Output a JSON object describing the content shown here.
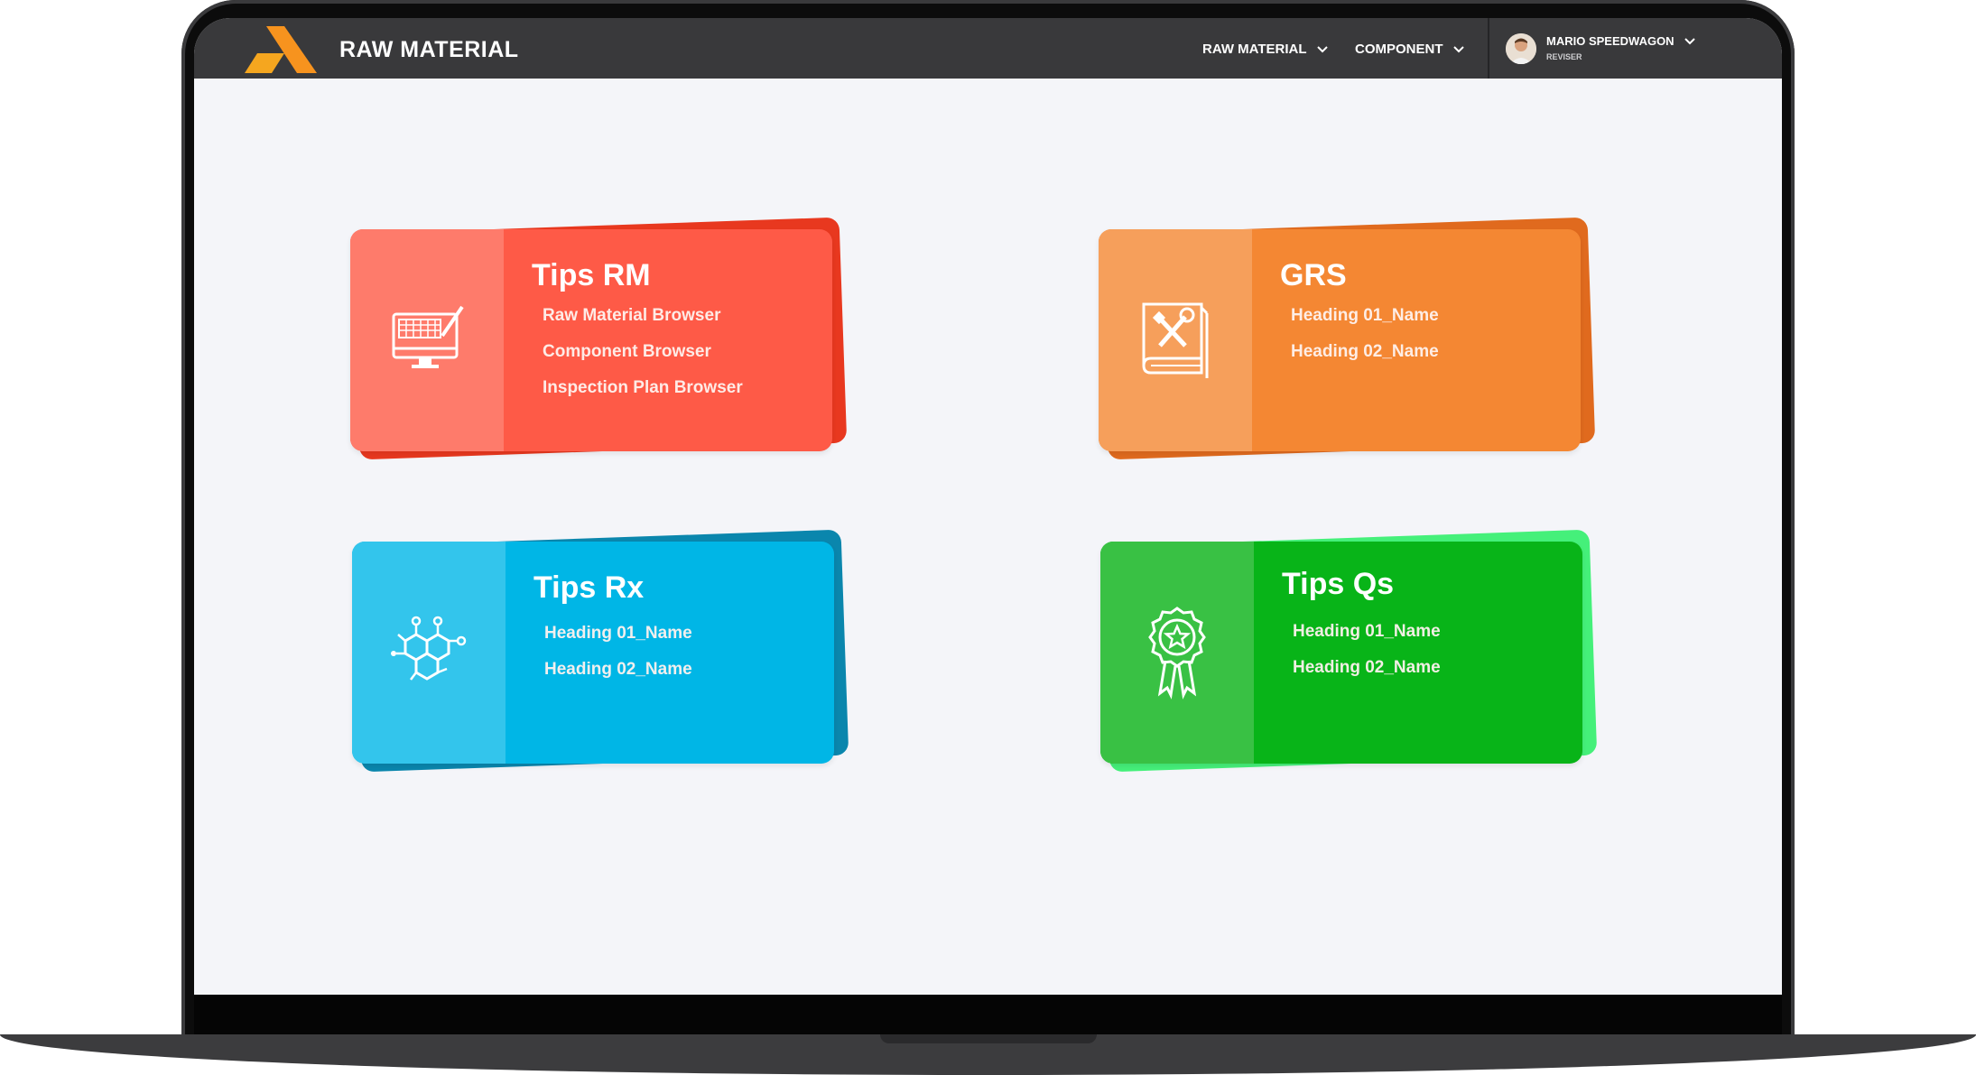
{
  "app": {
    "title": "RAW MATERIAL"
  },
  "nav": {
    "items": [
      {
        "label": "RAW MATERIAL"
      },
      {
        "label": "COMPONENT"
      }
    ]
  },
  "user": {
    "name": "MARIO SPEEDWAGON",
    "role": "REVISER"
  },
  "icons": {
    "logo": "logo-a-icon",
    "nav_chevron": "chevron-down-icon",
    "cards": [
      "computer-keyboard-pen-icon",
      "tools-book-icon",
      "molecule-icon",
      "award-ribbon-icon"
    ]
  },
  "colors": {
    "appbar": "#39393b",
    "screen_bg": "#f4f5f9",
    "logo_orange": "#f5a61f",
    "card_rm": "#fe5a47",
    "card_grs": "#f48733",
    "card_rx": "#00b6e6",
    "card_qs": "#08b418"
  },
  "cards": [
    {
      "title": "Tips RM",
      "links": [
        "Raw Material Browser",
        "Component Browser",
        "Inspection Plan Browser"
      ]
    },
    {
      "title": "GRS",
      "links": [
        "Heading 01_Name",
        "Heading 02_Name"
      ]
    },
    {
      "title": "Tips Rx",
      "links": [
        "Heading 01_Name",
        "Heading 02_Name"
      ]
    },
    {
      "title": "Tips Qs",
      "links": [
        "Heading 01_Name",
        "Heading 02_Name"
      ]
    }
  ]
}
